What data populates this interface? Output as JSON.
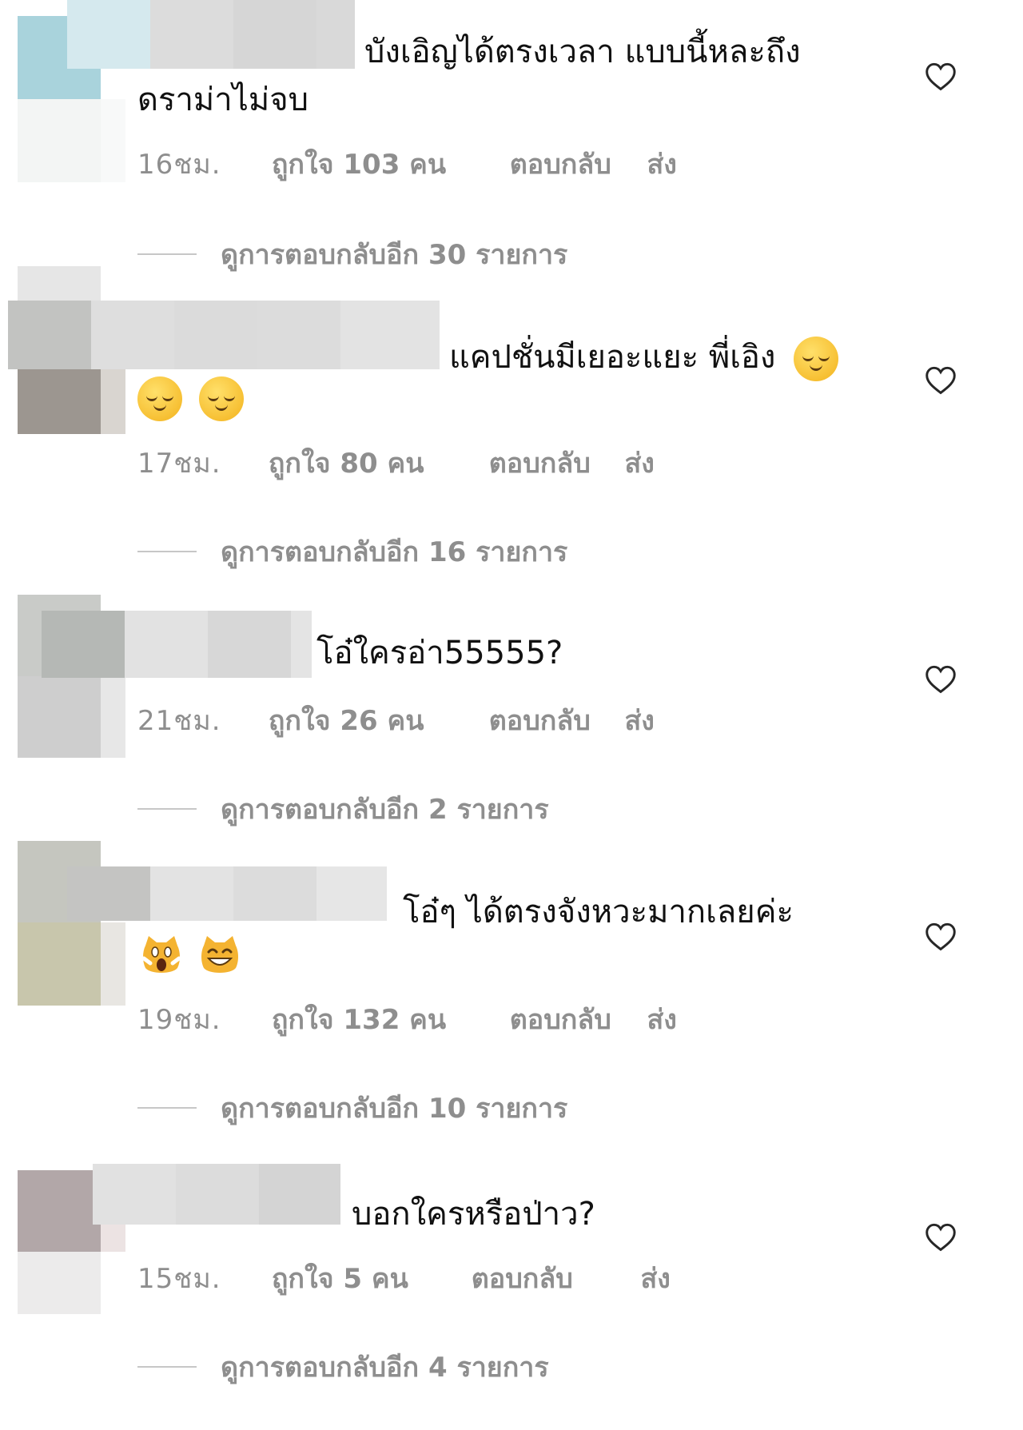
{
  "comments": [
    {
      "text_line1": "บังเอิญได้ตรงเวลา แบบนี้หละถึง",
      "text_line2": "ดราม่าไม่จบ",
      "time": "16ชม.",
      "likes": "ถูกใจ 103 คน",
      "reply": "ตอบกลับ",
      "send": "ส่ง",
      "view_replies": "ดูการตอบกลับอีก 30 รายการ"
    },
    {
      "text_line1": "แคปชั่นมีเยอะแยะ พี่เอิง",
      "emoji_line1": [
        "relieved-face"
      ],
      "emoji_line2": [
        "relieved-face",
        "relieved-face"
      ],
      "time": "17ชม.",
      "likes": "ถูกใจ 80 คน",
      "reply": "ตอบกลับ",
      "send": "ส่ง",
      "view_replies": "ดูการตอบกลับอีก 16 รายการ"
    },
    {
      "text_line1": "โอ๋ใครอ่า55555?",
      "time": "21ชม.",
      "likes": "ถูกใจ 26 คน",
      "reply": "ตอบกลับ",
      "send": "ส่ง",
      "view_replies": "ดูการตอบกลับอีก 2 รายการ"
    },
    {
      "text_line1": "โอ๋ๆ ได้ตรงจังหวะมากเลยค่ะ",
      "emoji_line2": [
        "weary-cat-face",
        "grinning-cat-face"
      ],
      "time": "19ชม.",
      "likes": "ถูกใจ 132 คน",
      "reply": "ตอบกลับ",
      "send": "ส่ง",
      "view_replies": "ดูการตอบกลับอีก 10 รายการ"
    },
    {
      "text_line1": "บอกใครหรือป่าว?",
      "time": "15ชม.",
      "likes": "ถูกใจ 5 คน",
      "reply": "ตอบกลับ",
      "send": "ส่ง",
      "view_replies": "ดูการตอบกลับอีก 4 รายการ"
    }
  ],
  "icons": {
    "like": "heart-outline-icon"
  },
  "colors": {
    "meta_gray": "#8e8e8e",
    "text": "#111111"
  }
}
